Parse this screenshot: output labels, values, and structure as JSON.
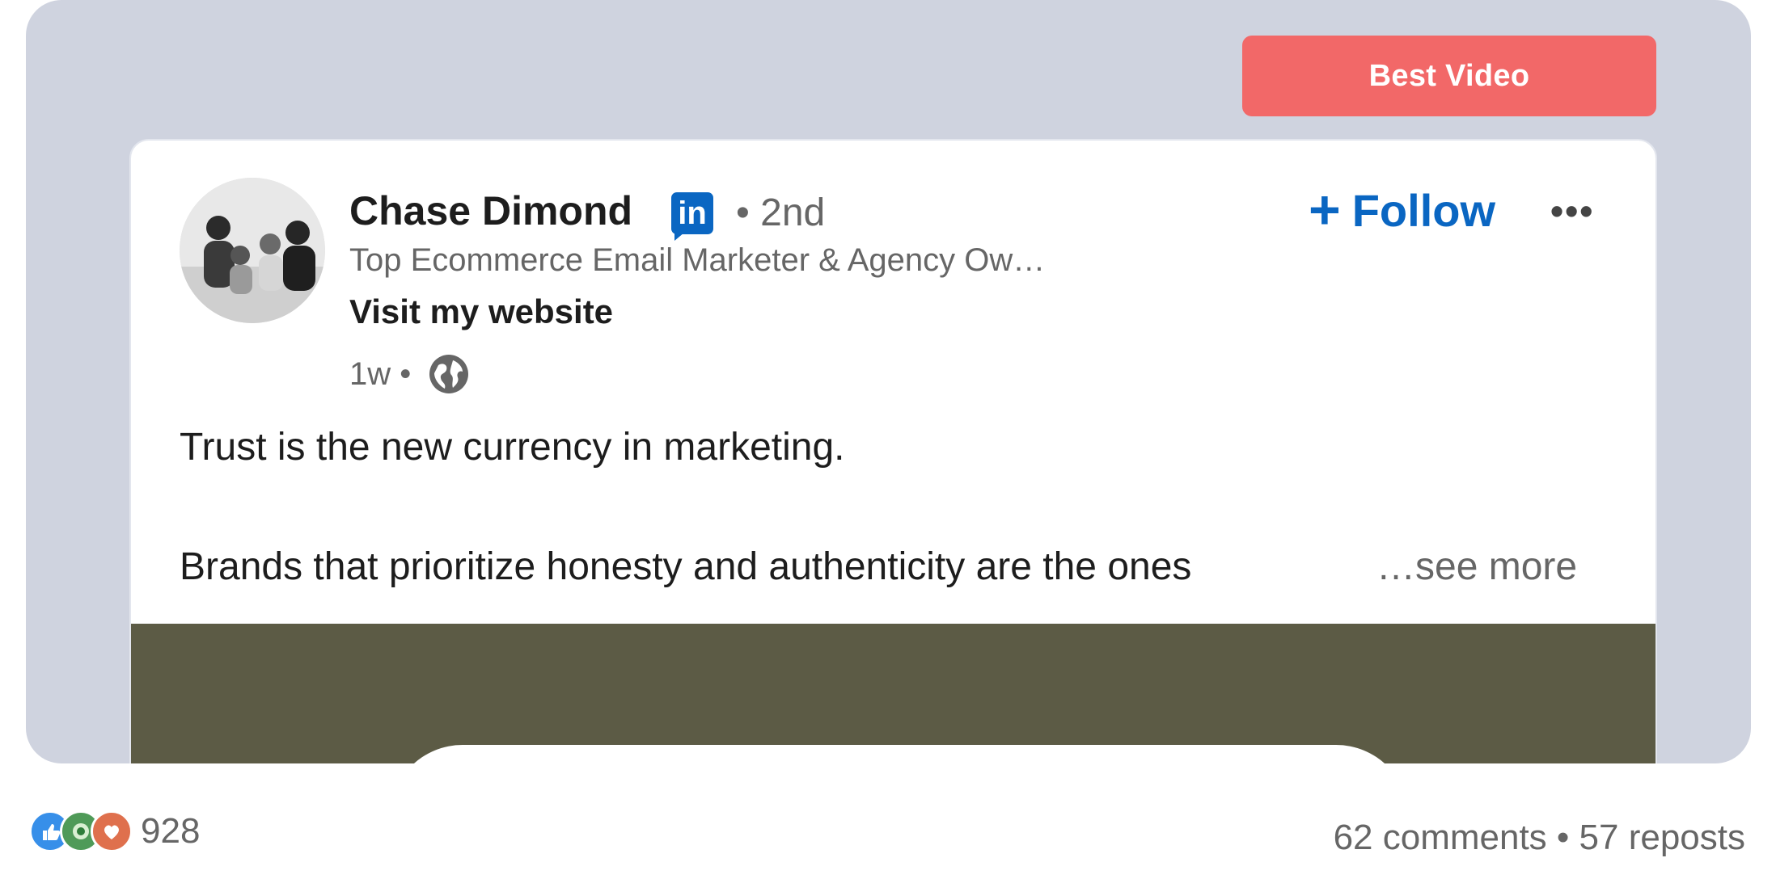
{
  "badge": {
    "label": "Best Video"
  },
  "post": {
    "author": {
      "name": "Chase Dimond",
      "network_icon": "linkedin-icon",
      "degree": "• 2nd",
      "headline": "Top Ecommerce Email Marketer & Agency Ow…",
      "website_link": "Visit my website",
      "time": "1w •",
      "visibility_icon": "globe-icon"
    },
    "follow_label": "Follow",
    "more_label": "•••",
    "text_line_1": "Trust is the new currency in marketing.",
    "text_line_2": "Brands that prioritize honesty and authenticity are the ones",
    "see_more_label": "…see more",
    "colors": {
      "link": "#0a66c2",
      "badge": "#f26868",
      "media_bg": "#5c5b45"
    }
  },
  "social": {
    "reaction_icons": [
      "like-icon",
      "support-icon",
      "love-icon"
    ],
    "reaction_count": "928",
    "engagement_text": "62 comments • 57 reposts"
  }
}
